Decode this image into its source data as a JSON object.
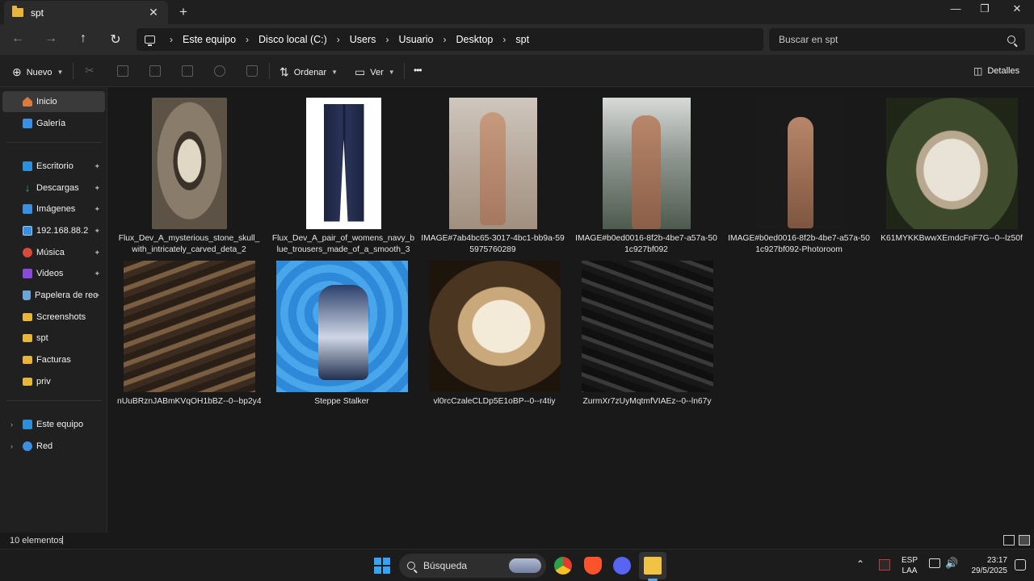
{
  "window": {
    "tab_title": "spt",
    "tab_close": "✕",
    "new_tab": "+",
    "minimize": "—",
    "maximize": "❐",
    "close": "✕"
  },
  "nav": {
    "back": "←",
    "forward": "→",
    "up": "↑",
    "refresh": "↻",
    "breadcrumbs": [
      "Este equipo",
      "Disco local (C:)",
      "Users",
      "Usuario",
      "Desktop",
      "spt"
    ],
    "search_placeholder": "Buscar en spt"
  },
  "toolbar": {
    "new_label": "Nuevo",
    "sort_label": "Ordenar",
    "view_label": "Ver",
    "more_label": "•••",
    "details_label": "Detalles"
  },
  "sidebar": {
    "items": [
      {
        "label": "Inicio",
        "icon": "home-icon",
        "selected": true
      },
      {
        "label": "Galería",
        "icon": "gallery-icon"
      },
      {
        "label": "Escritorio",
        "icon": "desktop-icon",
        "pinned": true
      },
      {
        "label": "Descargas",
        "icon": "download-icon",
        "pinned": true
      },
      {
        "label": "Imágenes",
        "icon": "images-icon",
        "pinned": true
      },
      {
        "label": "192.168.88.2",
        "icon": "network-drive-icon",
        "pinned": true
      },
      {
        "label": "Música",
        "icon": "music-icon",
        "pinned": true
      },
      {
        "label": "Videos",
        "icon": "video-icon",
        "pinned": true
      },
      {
        "label": "Papelera de reciclaje",
        "icon": "recycle-bin-icon",
        "pinned": true
      },
      {
        "label": "Screenshots",
        "icon": "folder-icon"
      },
      {
        "label": "spt",
        "icon": "folder-icon"
      },
      {
        "label": "Facturas",
        "icon": "folder-icon"
      },
      {
        "label": "priv",
        "icon": "folder-icon"
      },
      {
        "label": "Este equipo",
        "icon": "computer-icon",
        "expandable": true
      },
      {
        "label": "Red",
        "icon": "network-icon",
        "expandable": true
      }
    ],
    "pin_glyph": "📌",
    "expand_glyph": "›"
  },
  "files": [
    {
      "name": "Flux_Dev_A_mysterious_stone_skull_with_intricately_carved_deta_2"
    },
    {
      "name": "Flux_Dev_A_pair_of_womens_navy_blue_trousers_made_of_a_smooth_3"
    },
    {
      "name": "IMAGE#7ab4bc65-3017-4bc1-bb9a-595975760289"
    },
    {
      "name": "IMAGE#b0ed0016-8f2b-4be7-a57a-501c927bf092"
    },
    {
      "name": "IMAGE#b0ed0016-8f2b-4be7-a57a-501c927bf092-Photoroom"
    },
    {
      "name": "K61MYKKBwwXEmdcFnF7G--0--lz50f"
    },
    {
      "name": "nUuBRznJABmKVqOH1bBZ--0--bp2y4"
    },
    {
      "name": "Steppe Stalker"
    },
    {
      "name": "vl0rcCzaleCLDp5E1oBP--0--r4tiy"
    },
    {
      "name": "ZurmXr7zUyMqtmfVIAEz--0--ln67y"
    }
  ],
  "status": {
    "item_count": "10 elementos",
    "cursor": "|"
  },
  "taskbar": {
    "search_label": "Búsqueda",
    "lang_top": "ESP",
    "lang_bottom": "LAA",
    "time": "23:17",
    "date": "29/5/2025",
    "chevron": "⌃"
  }
}
